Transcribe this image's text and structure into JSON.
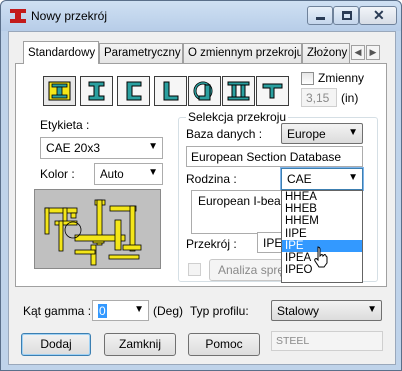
{
  "window": {
    "title": "Nowy przekrój",
    "icons": [
      "app-beam-icon",
      "minimize-icon",
      "maximize-icon",
      "close-icon"
    ]
  },
  "tabs": [
    {
      "label": "Standardowy",
      "active": true
    },
    {
      "label": "Parametryczny",
      "active": false
    },
    {
      "label": "O zmiennym przekroju",
      "active": false
    },
    {
      "label": "Złożony",
      "active": false
    }
  ],
  "section_types": [
    "i-section-combined-icon",
    "i-beam-icon",
    "channel-icon",
    "angle-icon",
    "pipe-angle-icon",
    "double-i-icon",
    "t-section-icon"
  ],
  "variable": {
    "label": "Zmienny",
    "checked": false,
    "value": "3,15",
    "unit": "(in)"
  },
  "label_field": {
    "label": "Etykieta :",
    "value": "CAE 20x3"
  },
  "color": {
    "label": "Kolor :",
    "value": "Auto"
  },
  "selection": {
    "group_title": "Selekcja przekroju",
    "database_label": "Baza danych :",
    "database_value": "Europe",
    "database_full": "European Section Database",
    "family_label": "Rodzina :",
    "family_value": "CAE",
    "family_description": "European I-beams",
    "family_options": [
      "HHEA",
      "HHEB",
      "HHEM",
      "IIPE",
      "IPE",
      "IPEA",
      "IPEO"
    ],
    "family_highlighted": "IPE",
    "section_label": "Przekrój :",
    "section_value": "IPE",
    "analysis_label": "Analiza spręż"
  },
  "gamma": {
    "label": "Kąt gamma :",
    "value": "0",
    "unit": "(Deg)"
  },
  "profile": {
    "label": "Typ profilu:",
    "value": "Stalowy"
  },
  "buttons": {
    "add": "Dodaj",
    "close": "Zamknij",
    "help": "Pomoc"
  },
  "material": "STEEL"
}
